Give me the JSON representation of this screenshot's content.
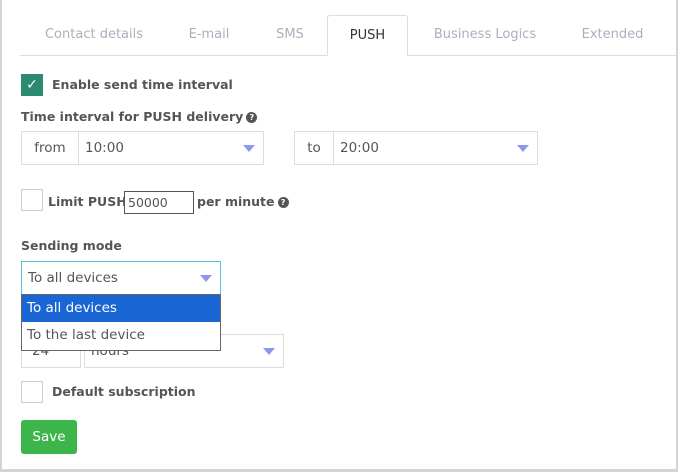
{
  "tabs": [
    {
      "label": "Contact details"
    },
    {
      "label": "E-mail"
    },
    {
      "label": "SMS"
    },
    {
      "label": "PUSH",
      "active": true
    },
    {
      "label": "Business Logics"
    },
    {
      "label": "Extended"
    }
  ],
  "enable_interval": {
    "label": "Enable send time interval",
    "checked": true
  },
  "interval": {
    "label": "Time interval for PUSH delivery",
    "from_label": "from",
    "from_value": "10:00",
    "to_label": "to",
    "to_value": "20:00"
  },
  "limit": {
    "label": "Limit PUSH",
    "value": "50000",
    "suffix": "per minute",
    "checked": false
  },
  "sending_mode": {
    "label": "Sending mode",
    "value": "To all devices",
    "options": [
      "To all devices",
      "To the last device"
    ]
  },
  "ttl": {
    "value": "24",
    "unit": "hours"
  },
  "default_subscription": {
    "label": "Default subscription",
    "checked": false
  },
  "save_label": "Save",
  "colors": {
    "checkbox_on": "#2a8a72",
    "save": "#3cb54a",
    "option_highlight": "#1a66d4",
    "caret": "#8f97e8"
  }
}
